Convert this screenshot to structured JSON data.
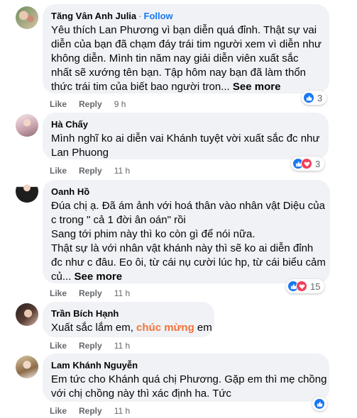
{
  "comments": [
    {
      "author": "Tăng Vân Anh Julia",
      "separator": "·",
      "follow": "Follow",
      "lines": [
        "Yêu thích Lan Phương vì bạn diễn quá đỉnh. Thật sự vai",
        "diễn của bạn đã chạm đáy trái tim người xem vì diễn như",
        "không diễn. Mình tin năm nay giải diễn viên xuất sắc",
        "nhất sẽ xướng tên bạn. Tập hôm nay bạn đã làm thổn",
        "thức trái tim của biết bao người tron..."
      ],
      "see_more": "See more",
      "like": "Like",
      "reply": "Reply",
      "time": "9 h",
      "reaction_count": "3",
      "reactions": [
        "like"
      ]
    },
    {
      "author": "Hà Chấy",
      "lines": [
        "Mình nghĩ ko ai diễn vai Khánh tuyệt vời xuất sắc đc như",
        "Lan Phuong"
      ],
      "like": "Like",
      "reply": "Reply",
      "time": "11 h",
      "reaction_count": "3",
      "reactions": [
        "like",
        "love"
      ]
    },
    {
      "author": "Oanh Hồ",
      "lines": [
        "Đúa chị ạ. Đã ám ảnh với hoá thân vào nhân vật Diệu của",
        "c trong \" cả 1 đời ân oán\" rồi",
        "Sang tới phim này thì ko còn gì để nói nữa.",
        "Thật sự là với nhân vật khánh này thì sẽ ko ai diễn đỉnh",
        "đc như c đâu. Eo ôi, từ cái nụ cười lúc hp, từ cái biểu cảm",
        "củ..."
      ],
      "see_more": "See more",
      "like": "Like",
      "reply": "Reply",
      "time": "11 h",
      "reaction_count": "15",
      "reactions": [
        "like",
        "love"
      ]
    },
    {
      "author": "Trần Bích Hạnh",
      "text_before": "Xuất sắc lắm em, ",
      "text_highlight": "chúc mừng",
      "text_after": " em",
      "like": "Like",
      "reply": "Reply",
      "time": "11 h"
    },
    {
      "author": "Lam Khánh Nguyễn",
      "lines": [
        "Em tức cho Khánh quá chị Phương. Gặp em thì mẹ chồng",
        "với chị chồng này thì xác định ha. Tức"
      ],
      "like": "Like",
      "reply": "Reply",
      "time": "11 h",
      "reactions": [
        "like"
      ]
    }
  ],
  "colors": {
    "bubble": "#f0f2f5",
    "link": "#1877f2",
    "like_reaction": "#1877f2",
    "love_reaction": "#f33e58",
    "highlight_text": "#f0743a",
    "secondary_text": "#65676b"
  },
  "icons": [
    "like-reaction-icon",
    "love-reaction-icon"
  ]
}
